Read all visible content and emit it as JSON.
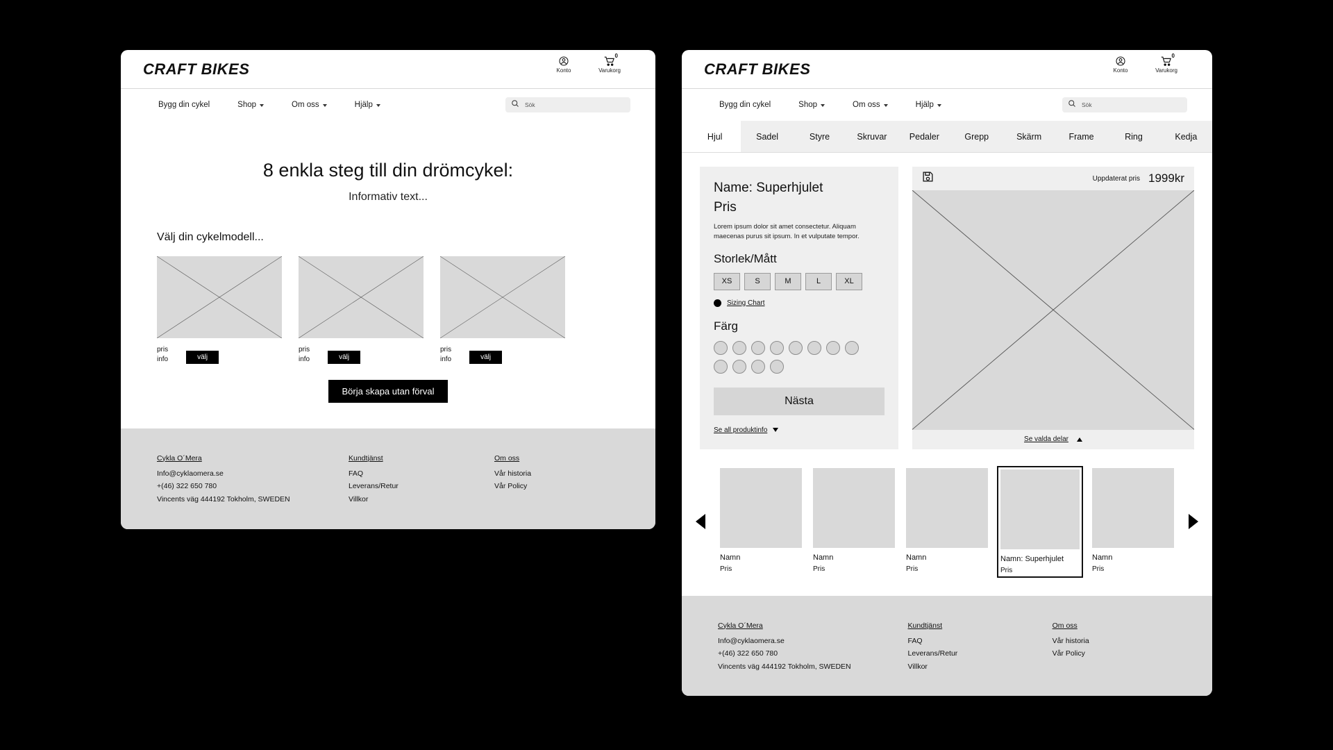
{
  "brand": "CRAFT BIKES",
  "header": {
    "account_label": "Konto",
    "cart_label": "Varukorg",
    "cart_count": "0"
  },
  "nav": {
    "items": [
      {
        "label": "Bygg din cykel",
        "has_caret": false
      },
      {
        "label": "Shop",
        "has_caret": true
      },
      {
        "label": "Om oss",
        "has_caret": true
      },
      {
        "label": "Hjälp",
        "has_caret": true
      }
    ],
    "search_placeholder": "Sök"
  },
  "left_page": {
    "title": "8 enkla steg till din drömcykel:",
    "subtitle": "Informativ text...",
    "choose_label": "Välj din cykelmodell...",
    "cards": [
      {
        "price": "pris",
        "info": "info",
        "button": "välj"
      },
      {
        "price": "pris",
        "info": "info",
        "button": "välj"
      },
      {
        "price": "pris",
        "info": "info",
        "button": "välj"
      }
    ],
    "start_button": "Börja skapa utan förval"
  },
  "right_page": {
    "tabs": [
      {
        "label": "Hjul",
        "active": true
      },
      {
        "label": "Sadel",
        "active": false
      },
      {
        "label": "Styre",
        "active": false
      },
      {
        "label": "Skruvar",
        "active": false
      },
      {
        "label": "Pedaler",
        "active": false
      },
      {
        "label": "Grepp",
        "active": false
      },
      {
        "label": "Skärm",
        "active": false
      },
      {
        "label": "Frame",
        "active": false
      },
      {
        "label": "Ring",
        "active": false
      },
      {
        "label": "Kedja",
        "active": false
      }
    ],
    "detail": {
      "name": "Name: Superhjulet",
      "price": "Pris",
      "description": "Lorem ipsum dolor sit amet consectetur. Aliquam maecenas purus sit ipsum. In et vulputate tempor.",
      "size_heading": "Storlek/Mått",
      "sizes": [
        "XS",
        "S",
        "M",
        "L",
        "XL"
      ],
      "sizing_chart_link": "Sizing Chart",
      "color_heading": "Färg",
      "swatch_count": 12,
      "next_button": "Nästa",
      "product_info_link": "Se all produktinfo"
    },
    "preview": {
      "save_icon": "floppy-disk-icon",
      "updated_price_label": "Uppdaterat pris",
      "updated_price_value": "1999kr",
      "selected_parts_link": "Se valda delar"
    },
    "carousel": {
      "prev": "previous-arrow",
      "next": "next-arrow",
      "items": [
        {
          "name": "Namn",
          "price": "Pris",
          "selected": false
        },
        {
          "name": "Namn",
          "price": "Pris",
          "selected": false
        },
        {
          "name": "Namn",
          "price": "Pris",
          "selected": false
        },
        {
          "name": "Namn: Superhjulet",
          "price": "Pris",
          "selected": true
        },
        {
          "name": "Namn",
          "price": "Pris",
          "selected": false
        }
      ]
    }
  },
  "footer": {
    "col1": {
      "heading": "Cykla O´Mera",
      "items": [
        "Info@cyklaomera.se",
        "+(46) 322 650 780",
        "Vincents väg 444192 Tokholm, SWEDEN"
      ]
    },
    "col2": {
      "heading": "Kundtjänst",
      "items": [
        "FAQ",
        "Leverans/Retur",
        "Villkor"
      ]
    },
    "col3": {
      "heading": "Om oss",
      "items": [
        "Vår historia",
        "Vår Policy"
      ]
    }
  },
  "colors": {
    "background": "#000000",
    "panel": "#ffffff",
    "footer_bg": "#d9d9d9",
    "placeholder": "#d9d9d9",
    "pane_bg": "#efefef",
    "accent": "#000000"
  }
}
